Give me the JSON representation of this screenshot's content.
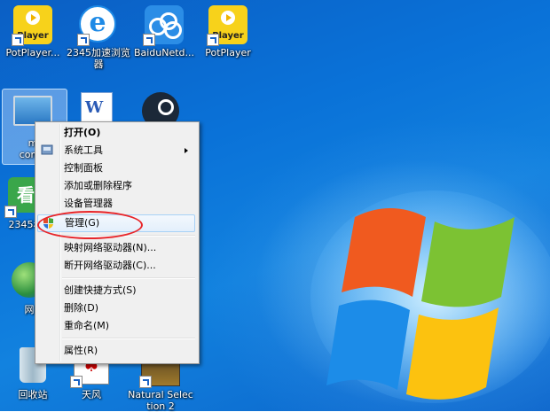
{
  "desktop": {
    "icons": [
      {
        "label": "PotPlayer...",
        "type": "potplayer",
        "badge": "Player"
      },
      {
        "label": "2345加速浏览器",
        "type": "ie-browser",
        "glyph": "e"
      },
      {
        "label": "BaiduNetd...",
        "type": "baidu-netdisk"
      },
      {
        "label": "PotPlayer",
        "type": "potplayer",
        "badge": "Player"
      },
      {
        "label_partial_1": "m",
        "label_partial_2": "comp",
        "type": "computer"
      },
      {
        "label": "",
        "type": "word-doc",
        "glyph": "W"
      },
      {
        "label": "",
        "type": "steam"
      },
      {
        "label": "2345看",
        "type": "2345-video",
        "glyph": "看"
      },
      {
        "label": "网",
        "type": "network"
      },
      {
        "label": "回收站",
        "type": "recycle-bin"
      },
      {
        "label": "天风",
        "type": "solitaire",
        "glyph": "♠"
      },
      {
        "label": "Natural Selection 2",
        "type": "game"
      }
    ]
  },
  "context_menu": {
    "items": [
      {
        "label": "打开(O)",
        "bold": true
      },
      {
        "label": "系统工具",
        "submenu": true
      },
      {
        "label": "控制面板"
      },
      {
        "label": "添加或删除程序"
      },
      {
        "label": "设备管理器"
      },
      {
        "label": "管理(G)",
        "highlighted": true,
        "annotated": true
      },
      {
        "label": "映射网络驱动器(N)..."
      },
      {
        "label": "断开网络驱动器(C)..."
      },
      {
        "label": "创建快捷方式(S)"
      },
      {
        "label": "删除(D)"
      },
      {
        "label": "重命名(M)"
      },
      {
        "label": "属性(R)"
      }
    ]
  },
  "colors": {
    "annotation_ring": "#e8262a",
    "menu_highlight_border": "#a8d1f6"
  }
}
